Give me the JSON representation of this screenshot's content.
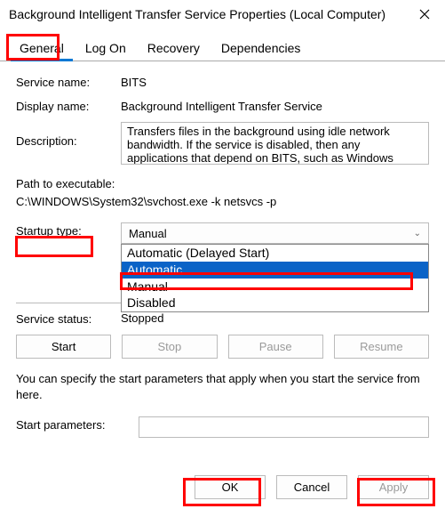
{
  "titlebar": {
    "title": "Background Intelligent Transfer Service Properties (Local Computer)"
  },
  "tabs": {
    "general": "General",
    "logon": "Log On",
    "recovery": "Recovery",
    "dependencies": "Dependencies"
  },
  "labels": {
    "service_name": "Service name:",
    "display_name": "Display name:",
    "description": "Description:",
    "path": "Path to executable:",
    "startup_type": "Startup type:",
    "service_status": "Service status:",
    "start_params": "Start parameters:"
  },
  "values": {
    "service_name": "BITS",
    "display_name": "Background Intelligent Transfer Service",
    "description": "Transfers files in the background using idle network bandwidth. If the service is disabled, then any applications that depend on BITS, such as Windows",
    "path": "C:\\WINDOWS\\System32\\svchost.exe -k netsvcs -p",
    "startup_selected": "Manual",
    "service_status": "Stopped",
    "start_params": ""
  },
  "dropdown": {
    "opt0": "Automatic (Delayed Start)",
    "opt1": "Automatic",
    "opt2": "Manual",
    "opt3": "Disabled"
  },
  "buttons": {
    "start": "Start",
    "stop": "Stop",
    "pause": "Pause",
    "resume": "Resume",
    "ok": "OK",
    "cancel": "Cancel",
    "apply": "Apply"
  },
  "hint": "You can specify the start parameters that apply when you start the service from here."
}
